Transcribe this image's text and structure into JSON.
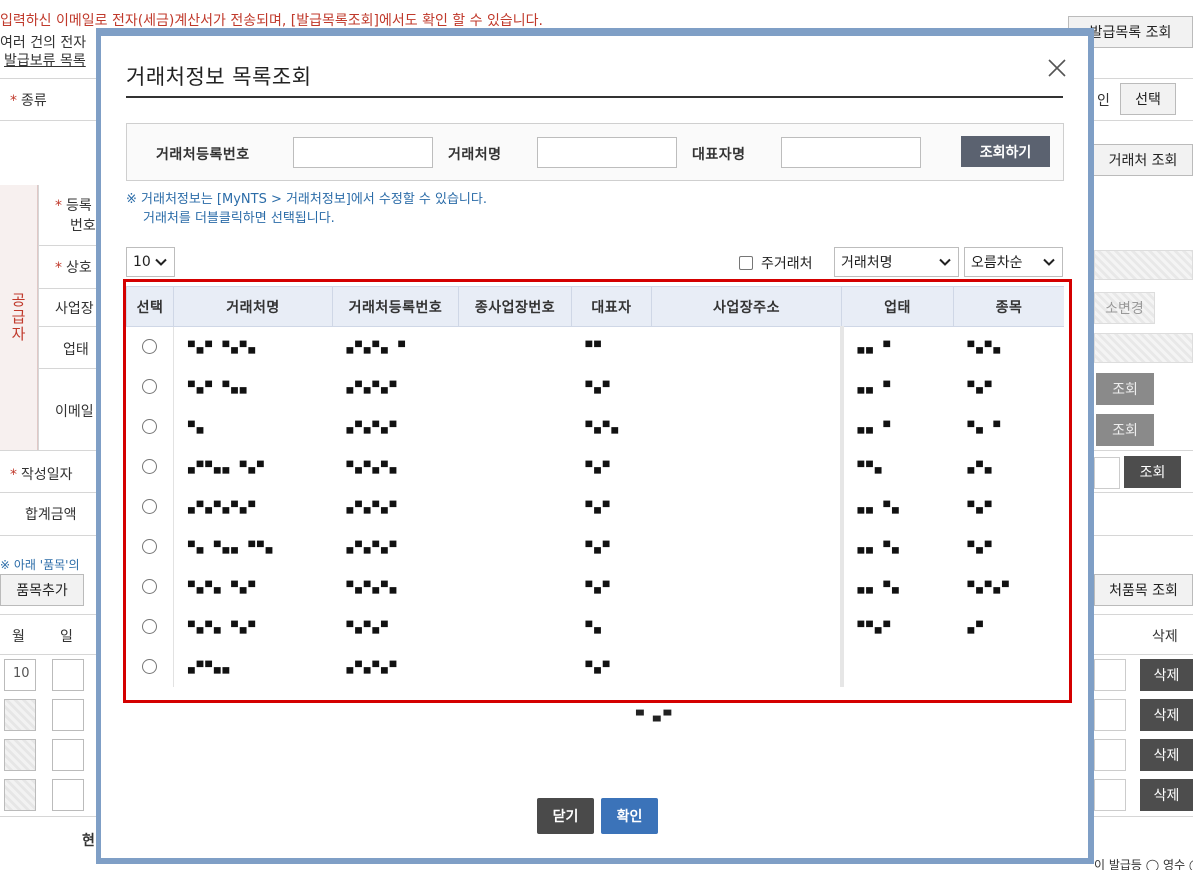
{
  "background": {
    "notice": "입력하신 이메일로 전자(세금)계산서가 전송되며, [발급목록조회]에서도 확인 할 수 있습니다.",
    "notice_line2": "여러 건의 전자",
    "notice_link": "발급보류 목록",
    "issue_list_button": "발급목록 조회",
    "select_button": "선택",
    "in_label": "인",
    "partner_lookup_button": "거래처 조회",
    "type_label": "종류",
    "reg_label_1": "등록",
    "reg_label_2": "번호",
    "trade_name_label": "상호",
    "biz_label": "사업장",
    "business_type_label": "업태",
    "email_label": "이메일",
    "supplier_label": "공급자",
    "address_change_button": "소변경",
    "lookup_button_1": "조회",
    "lookup_button_2": "조회",
    "lookup_button_3": "조회",
    "date_label": "작성일자",
    "total_label": "합계금액",
    "item_note": "※ 아래 '품목'의",
    "add_item_button": "품목추가",
    "item_lookup_button": "처품목 조회",
    "month_header": "월",
    "day_header": "일",
    "delete_header": "삭제",
    "first_month_value": "10",
    "delete_buttons": [
      "삭제",
      "삭제",
      "삭제",
      "삭제"
    ],
    "bottom_label": "현",
    "bottom_right": "이 발급등 ◯ 영수 ◯ 청"
  },
  "modal": {
    "title": "거래처정보 목록조회",
    "search": {
      "reg_no_label": "거래처등록번호",
      "reg_no_value": "",
      "name_label": "거래처명",
      "name_value": "",
      "ceo_label": "대표자명",
      "ceo_value": "",
      "search_button": "조회하기"
    },
    "note_line1": "※ 거래처정보는 [MyNTS > 거래처정보]에서 수정할 수 있습니다.",
    "note_line2": "거래처를 더블클릭하면 선택됩니다.",
    "page_size": "10",
    "main_partner_label": "주거래처",
    "sort_field": "거래처명",
    "sort_order": "오름차순",
    "table": {
      "headers": [
        "선택",
        "거래처명",
        "거래처등록번호",
        "종사업장번호",
        "대표자",
        "사업장주소",
        "업태",
        "종목"
      ],
      "rows": [
        {
          "name": "▀▄▀ ▀▄▀▄",
          "reg_no": "▄▀▄▀▄ ▀",
          "sub_no": "",
          "ceo": "▀▀",
          "address": "",
          "biz_type": "▄▄ ▀",
          "item": "▀▄▀▄"
        },
        {
          "name": "▀▄▀ ▀▄▄",
          "reg_no": "▄▀▄▀▄▀",
          "sub_no": "",
          "ceo": "▀▄▀",
          "address": "",
          "biz_type": "▄▄ ▀",
          "item": "▀▄▀"
        },
        {
          "name": "▀▄",
          "reg_no": "▄▀▄▀▄▀",
          "sub_no": "",
          "ceo": "▀▄▀▄",
          "address": "",
          "biz_type": "▄▄ ▀",
          "item": "▀▄ ▀"
        },
        {
          "name": "▄▀▀▄▄ ▀▄▀",
          "reg_no": "▀▄▀▄▀▄",
          "sub_no": "",
          "ceo": "▀▄▀",
          "address": "",
          "biz_type": "▀▀▄",
          "item": "▄▀▄"
        },
        {
          "name": "▄▀▄▀▄▀▄▀",
          "reg_no": "▄▀▄▀▄▀",
          "sub_no": "",
          "ceo": "▀▄▀",
          "address": "",
          "biz_type": "▄▄ ▀▄",
          "item": "▀▄▀"
        },
        {
          "name": "▀▄ ▀▄▄ ▀▀▄",
          "reg_no": "▄▀▄▀▄▀",
          "sub_no": "",
          "ceo": "▀▄▀",
          "address": "",
          "biz_type": "▄▄ ▀▄",
          "item": "▀▄▀"
        },
        {
          "name": "▀▄▀▄ ▀▄▀",
          "reg_no": "▀▄▀▄▀▄",
          "sub_no": "",
          "ceo": "▀▄▀",
          "address": "",
          "biz_type": "▄▄ ▀▄",
          "item": "▀▄▀▄▀"
        },
        {
          "name": "▀▄▀▄ ▀▄▀",
          "reg_no": "▀▄▀▄▀",
          "sub_no": "",
          "ceo": "▀▄",
          "address": "",
          "biz_type": "▀▀▄▀",
          "item": "▄▀"
        },
        {
          "name": "▄▀▀▄▄",
          "reg_no": "▄▀▄▀▄▀",
          "sub_no": "",
          "ceo": "▀▄▀",
          "address": "",
          "biz_type": "",
          "item": ""
        }
      ]
    },
    "pager_text": "▀ ▄▀",
    "close_button": "닫기",
    "confirm_button": "확인",
    "colors": {
      "frame": "#7f9fc6",
      "highlight": "#d40000",
      "search_button": "#5b6270",
      "close_button": "#4a4a4a",
      "confirm_button": "#3b73b9",
      "header_bg": "#e8edf6",
      "note_text": "#2b6ca8"
    },
    "icons": {
      "close": "close-icon",
      "dropdown": "chevron-down-icon"
    }
  }
}
